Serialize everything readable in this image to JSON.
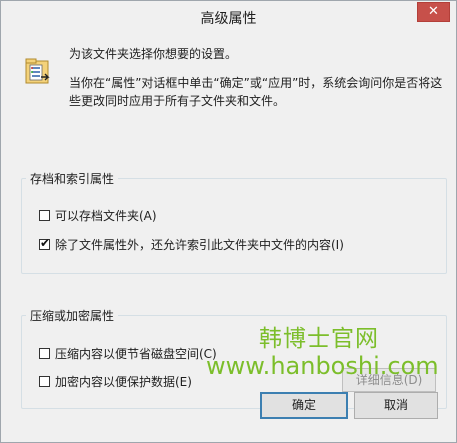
{
  "window": {
    "title": "高级属性",
    "close_symbol": "✕"
  },
  "intro": {
    "line1": "为该文件夹选择你想要的设置。",
    "line2": "当你在“属性”对话框中单击“确定”或“应用”时，系统会询问你是否将这些更改同时应用于所有子文件夹和文件。",
    "icon": "folder-settings-icon"
  },
  "archive_group": {
    "title": "存档和索引属性",
    "items": [
      {
        "label": "可以存档文件夹(A)",
        "checked": false
      },
      {
        "label": "除了文件属性外，还允许索引此文件夹中文件的内容(I)",
        "checked": true
      }
    ]
  },
  "compress_group": {
    "title": "压缩或加密属性",
    "items": [
      {
        "label": "压缩内容以便节省磁盘空间(C)",
        "checked": false
      },
      {
        "label": "加密内容以便保护数据(E)",
        "checked": false
      }
    ],
    "details_button": "详细信息(D)"
  },
  "buttons": {
    "ok": "确定",
    "cancel": "取消"
  },
  "watermark": {
    "line1": "韩博士官网",
    "line2": "www.hanboshi.com"
  },
  "colors": {
    "close_red": "#c7504a",
    "watermark_green": "#7cbe2b"
  }
}
